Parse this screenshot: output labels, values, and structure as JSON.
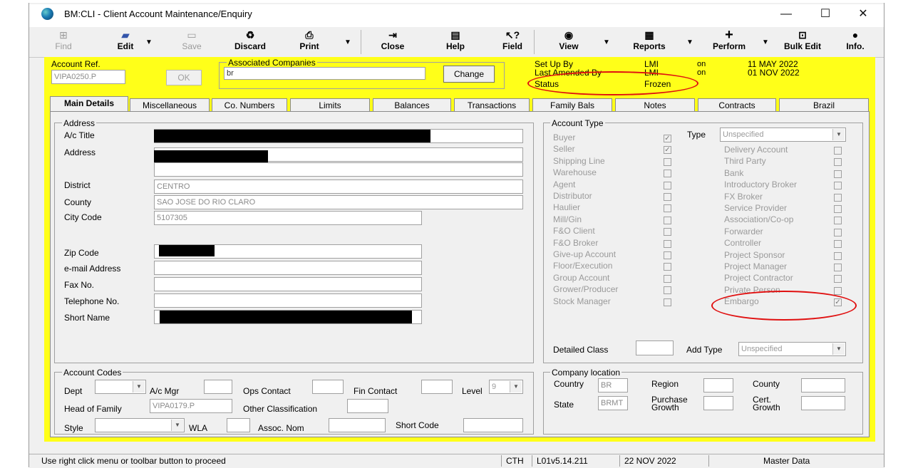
{
  "window": {
    "title": "BM:CLI - Client Account Maintenance/Enquiry",
    "minimize": "—",
    "maximize": "☐",
    "close": "✕"
  },
  "toolbar": {
    "find": "Find",
    "edit": "Edit",
    "save": "Save",
    "discard": "Discard",
    "print": "Print",
    "close": "Close",
    "help": "Help",
    "field": "Field",
    "view": "View",
    "reports": "Reports",
    "perform": "Perform",
    "bulk_edit": "Bulk Edit",
    "info": "Info."
  },
  "header": {
    "account_ref_label": "Account Ref.",
    "account_ref_value": "VIPA0250.P",
    "ok_label": "OK",
    "associated_label": "Associated Companies",
    "associated_value": "br",
    "change_label": "Change",
    "setup_label": "Set Up By",
    "setup_user": "LMI",
    "setup_on": "on",
    "setup_date": "11 MAY 2022",
    "amended_label": "Last Amended By",
    "amended_user": "LMI",
    "amended_on": "on",
    "amended_date": "01 NOV 2022",
    "status_label": "Status",
    "status_value": "Frozen"
  },
  "tabs": [
    "Main Details",
    "Miscellaneous",
    "Co. Numbers",
    "Limits",
    "Balances",
    "Transactions",
    "Family Bals",
    "Notes",
    "Contracts",
    "Brazil"
  ],
  "address": {
    "group": "Address",
    "title_label": "A/c Title",
    "address_label": "Address",
    "district_label": "District",
    "district_value": "CENTRO",
    "county_label": "County",
    "county_value": "SAO JOSE DO RIO CLARO",
    "city_label": "City Code",
    "city_value": "5107305",
    "zip_label": "Zip Code",
    "email_label": "e-mail Address",
    "fax_label": "Fax No.",
    "tel_label": "Telephone No.",
    "short_label": "Short Name"
  },
  "account_type": {
    "group": "Account Type",
    "type_label": "Type",
    "type_value": "Unspecified",
    "left": [
      {
        "label": "Buyer",
        "checked": "✓"
      },
      {
        "label": "Seller",
        "checked": "✓"
      },
      {
        "label": "Shipping Line",
        "checked": ""
      },
      {
        "label": "Warehouse",
        "checked": ""
      },
      {
        "label": "Agent",
        "checked": ""
      },
      {
        "label": "Distributor",
        "checked": ""
      },
      {
        "label": "Haulier",
        "checked": ""
      },
      {
        "label": "Mill/Gin",
        "checked": ""
      },
      {
        "label": "F&O Client",
        "checked": ""
      },
      {
        "label": "F&O Broker",
        "checked": ""
      },
      {
        "label": "Give-up Account",
        "checked": ""
      },
      {
        "label": "Floor/Execution",
        "checked": ""
      },
      {
        "label": "Group Account",
        "checked": ""
      },
      {
        "label": "Grower/Producer",
        "checked": ""
      },
      {
        "label": "Stock Manager",
        "checked": ""
      }
    ],
    "right": [
      {
        "label": "Delivery Account",
        "checked": ""
      },
      {
        "label": "Third Party",
        "checked": ""
      },
      {
        "label": "Bank",
        "checked": ""
      },
      {
        "label": "Introductory Broker",
        "checked": ""
      },
      {
        "label": "FX Broker",
        "checked": ""
      },
      {
        "label": "Service Provider",
        "checked": ""
      },
      {
        "label": "Association/Co-op",
        "checked": ""
      },
      {
        "label": "Forwarder",
        "checked": ""
      },
      {
        "label": "Controller",
        "checked": ""
      },
      {
        "label": "Project Sponsor",
        "checked": ""
      },
      {
        "label": "Project Manager",
        "checked": ""
      },
      {
        "label": "Project Contractor",
        "checked": ""
      },
      {
        "label": "Private Person",
        "checked": ""
      },
      {
        "label": "Embargo",
        "checked": "✓"
      }
    ],
    "detailed_label": "Detailed Class",
    "add_type_label": "Add Type",
    "add_type_value": "Unspecified"
  },
  "codes": {
    "group": "Account Codes",
    "dept_label": "Dept",
    "mgr_label": "A/c Mgr",
    "ops_label": "Ops Contact",
    "fin_label": "Fin Contact",
    "level_label": "Level",
    "level_value": "9",
    "hof_label": "Head of Family",
    "hof_value": "VIPA0179.P",
    "other_label": "Other Classification",
    "style_label": "Style",
    "wla_label": "WLA",
    "assoc_label": "Assoc. Nom",
    "short_code_label": "Short Code"
  },
  "location": {
    "group": "Company location",
    "country_label": "Country",
    "country_value": "BR",
    "region_label": "Region",
    "county_label": "County",
    "state_label": "State",
    "state_value": "BRMT",
    "purchase_label": "Purchase Growth",
    "cert_label": "Cert. Growth"
  },
  "statusbar": {
    "message": "Use right click menu or toolbar button to proceed",
    "user": "CTH",
    "version": "L01v5.14.211",
    "date": "22 NOV 2022",
    "mode": "Master Data"
  },
  "colors": {
    "background": "#ffff19",
    "annotation": "#e01010"
  }
}
